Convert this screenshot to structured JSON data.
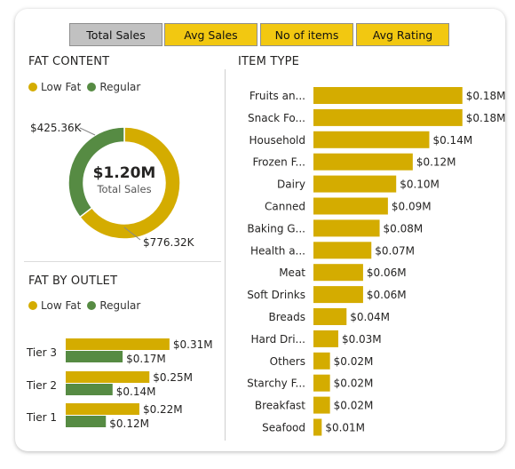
{
  "tabs": [
    {
      "label": "Total Sales",
      "active": true
    },
    {
      "label": "Avg Sales",
      "active": false
    },
    {
      "label": "No of items",
      "active": false
    },
    {
      "label": "Avg Rating",
      "active": false
    }
  ],
  "colors": {
    "low_fat": "#d4ac00",
    "regular": "#568b43",
    "bar": "#d4ac00",
    "tab_active": "#c1c1c1",
    "tab_inactive": "#f2c811"
  },
  "fat_content": {
    "title": "FAT CONTENT",
    "legend": [
      "Low Fat",
      "Regular"
    ],
    "center_value": "$1.20M",
    "center_label": "Total Sales",
    "label_regular": "$425.36K",
    "label_low_fat": "$776.32K"
  },
  "fat_by_outlet": {
    "title": "FAT BY OUTLET",
    "legend": [
      "Low Fat",
      "Regular"
    ]
  },
  "item_type": {
    "title": "ITEM TYPE"
  },
  "chart_data": [
    {
      "type": "pie",
      "title": "FAT CONTENT",
      "categories": [
        "Low Fat",
        "Regular"
      ],
      "values": [
        776.32,
        425.36
      ],
      "value_labels": [
        "$776.32K",
        "$425.36K"
      ],
      "center_value": "$1.20M",
      "center_label": "Total Sales",
      "legend": "top-left"
    },
    {
      "type": "bar",
      "title": "FAT BY OUTLET",
      "categories": [
        "Tier 3",
        "Tier 2",
        "Tier 1"
      ],
      "series": [
        {
          "name": "Low Fat",
          "values": [
            0.31,
            0.25,
            0.22
          ],
          "labels": [
            "$0.31M",
            "$0.25M",
            "$0.22M"
          ]
        },
        {
          "name": "Regular",
          "values": [
            0.17,
            0.14,
            0.12
          ],
          "labels": [
            "$0.17M",
            "$0.14M",
            "$0.12M"
          ]
        }
      ],
      "legend": "top-left"
    },
    {
      "type": "bar",
      "title": "ITEM TYPE",
      "categories": [
        "Fruits an...",
        "Snack Fo...",
        "Household",
        "Frozen F...",
        "Dairy",
        "Canned",
        "Baking G...",
        "Health a...",
        "Meat",
        "Soft Drinks",
        "Breads",
        "Hard Dri...",
        "Others",
        "Starchy F...",
        "Breakfast",
        "Seafood"
      ],
      "values": [
        0.18,
        0.18,
        0.14,
        0.12,
        0.1,
        0.09,
        0.08,
        0.07,
        0.06,
        0.06,
        0.04,
        0.03,
        0.02,
        0.02,
        0.02,
        0.01
      ],
      "labels": [
        "$0.18M",
        "$0.18M",
        "$0.14M",
        "$0.12M",
        "$0.10M",
        "$0.09M",
        "$0.08M",
        "$0.07M",
        "$0.06M",
        "$0.06M",
        "$0.04M",
        "$0.03M",
        "$0.02M",
        "$0.02M",
        "$0.02M",
        "$0.01M"
      ]
    }
  ]
}
